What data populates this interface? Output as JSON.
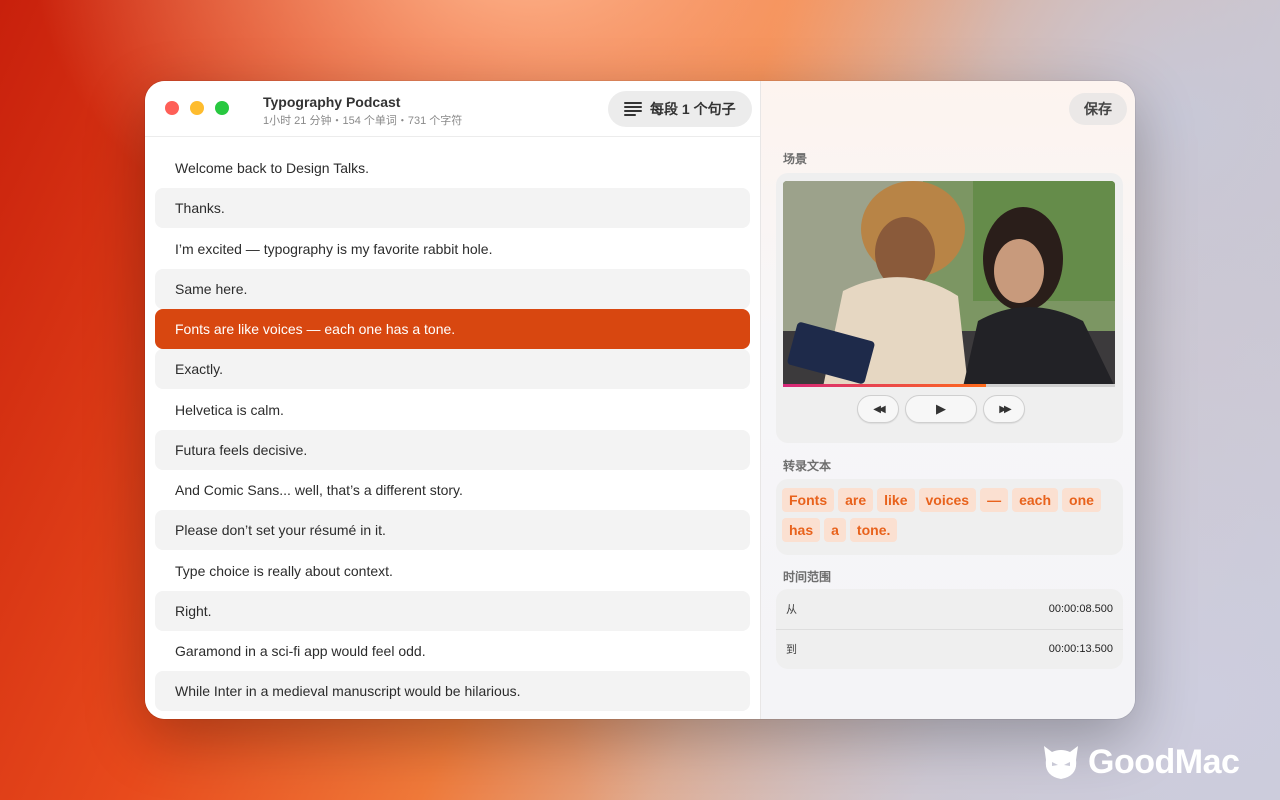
{
  "window": {
    "title": "Typography Podcast",
    "subtitle": "1小时 21 分钟・154 个单词・731 个字符",
    "mode_label": "每段 1 个句子",
    "save_label": "保存"
  },
  "sentences": [
    {
      "text": "Welcome back to Design Talks.",
      "state": "plain"
    },
    {
      "text": "Thanks.",
      "state": "alt"
    },
    {
      "text": "I’m excited — typography is my favorite rabbit hole.",
      "state": "plain"
    },
    {
      "text": "Same here.",
      "state": "alt"
    },
    {
      "text": "Fonts are like voices — each one has a tone.",
      "state": "active"
    },
    {
      "text": "Exactly.",
      "state": "alt"
    },
    {
      "text": "Helvetica is calm.",
      "state": "plain"
    },
    {
      "text": "Futura feels decisive.",
      "state": "alt"
    },
    {
      "text": "And Comic Sans... well, that’s a different story.",
      "state": "plain"
    },
    {
      "text": "Please don’t set your résumé in it.",
      "state": "alt"
    },
    {
      "text": "Type choice is really about context.",
      "state": "plain"
    },
    {
      "text": "Right.",
      "state": "alt"
    },
    {
      "text": "Garamond in a sci-fi app would feel odd.",
      "state": "plain"
    },
    {
      "text": "While Inter in a medieval manuscript would be hilarious.",
      "state": "alt"
    }
  ],
  "inspector": {
    "scene_label": "场景",
    "transcript_label": "转录文本",
    "range_label": "时间范围",
    "playback_progress": 0.61,
    "controls": {
      "rewind": "◀◀",
      "play": "▶",
      "forward": "▶▶"
    },
    "words": [
      "Fonts",
      "are",
      "like",
      "voices",
      "—",
      "each",
      "one",
      "has",
      "a",
      "tone."
    ],
    "from_label": "从",
    "from_value": "00:00:08.500",
    "to_label": "到",
    "to_value": "00:00:13.500"
  },
  "watermark": {
    "text": "GoodMac"
  },
  "colors": {
    "accent": "#d84710",
    "word_bg": "#fbe0d1",
    "word_text": "#e8621c"
  }
}
